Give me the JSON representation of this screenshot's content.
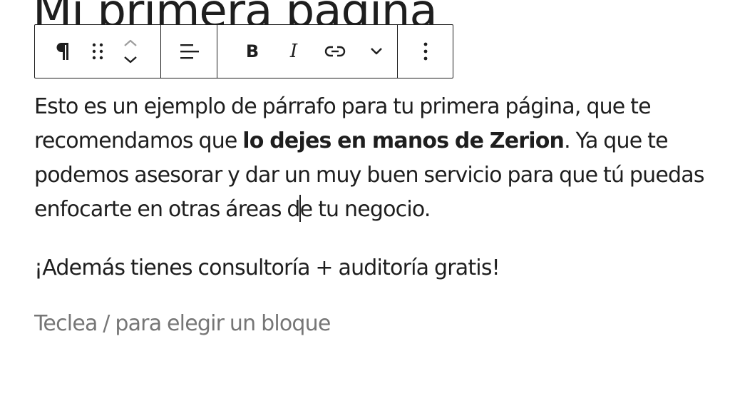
{
  "page": {
    "title": "Mi primera página"
  },
  "toolbar": {
    "paragraph_icon": "pilcrow-icon",
    "drag_icon": "drag-handle-icon",
    "move_up_icon": "chevron-up-icon",
    "move_down_icon": "chevron-down-icon",
    "align_icon": "align-left-icon",
    "bold_label": "B",
    "italic_label": "I",
    "link_icon": "link-icon",
    "more_formats_icon": "chevron-down-icon",
    "options_icon": "more-vertical-icon"
  },
  "content": {
    "paragraph1": {
      "line1": "Esto es un ejemplo de párrafo para tu primera página, que te",
      "line2_before": "recomendamos que ",
      "line2_bold": "lo dejes en manos de Zerion",
      "line2_after": ". Ya que te",
      "line3": "podemos asesorar y dar un muy buen servicio para que tú puedas",
      "line4_before_caret": "enfocarte en otras áreas d",
      "line4_after_caret": "e tu negocio."
    },
    "paragraph2": "¡Además tienes consultoría + auditoría gratis!",
    "placeholder": "Teclea / para elegir un bloque"
  }
}
